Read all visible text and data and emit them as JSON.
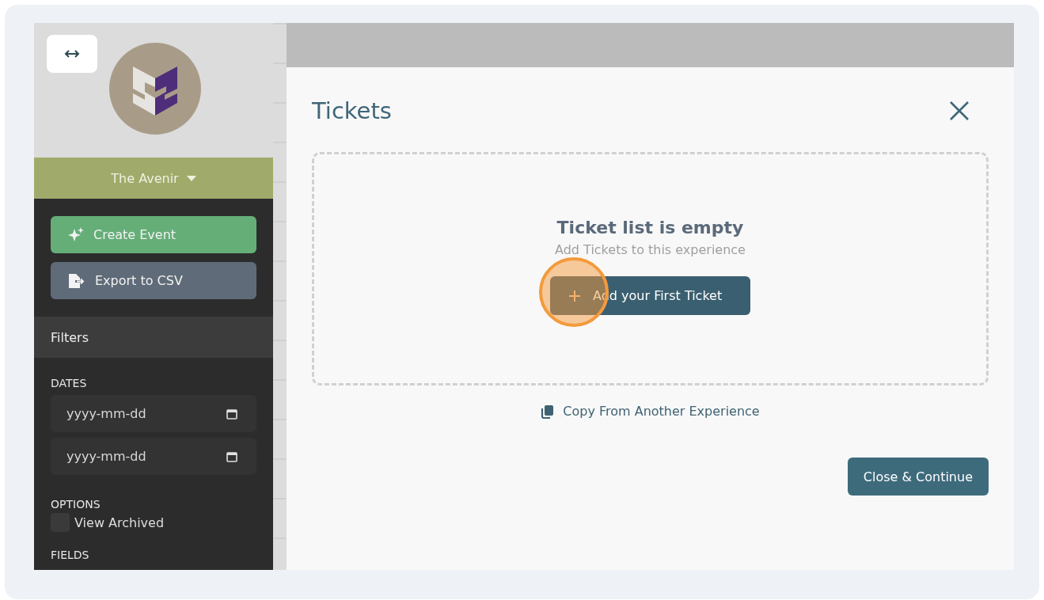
{
  "sidebar": {
    "venue": "The Avenir",
    "actions": [
      {
        "label": "Create Event",
        "kind": "create"
      },
      {
        "label": "Export to CSV",
        "kind": "export"
      }
    ],
    "filters_title": "Filters",
    "dates_label": "DATES",
    "date_fields": [
      {
        "placeholder": "yyyy-mm-dd"
      },
      {
        "placeholder": "yyyy-mm-dd"
      }
    ],
    "options_label": "OPTIONS",
    "options": [
      {
        "label": "View Archived",
        "checked": false
      }
    ],
    "fields_label": "FIELDS"
  },
  "modal": {
    "title": "Tickets",
    "empty_title": "Ticket list is empty",
    "empty_subtitle": "Add Tickets to this experience",
    "add_button": "Add your First Ticket",
    "copy_link": "Copy From Another Experience",
    "continue_button": "Close & Continue"
  }
}
